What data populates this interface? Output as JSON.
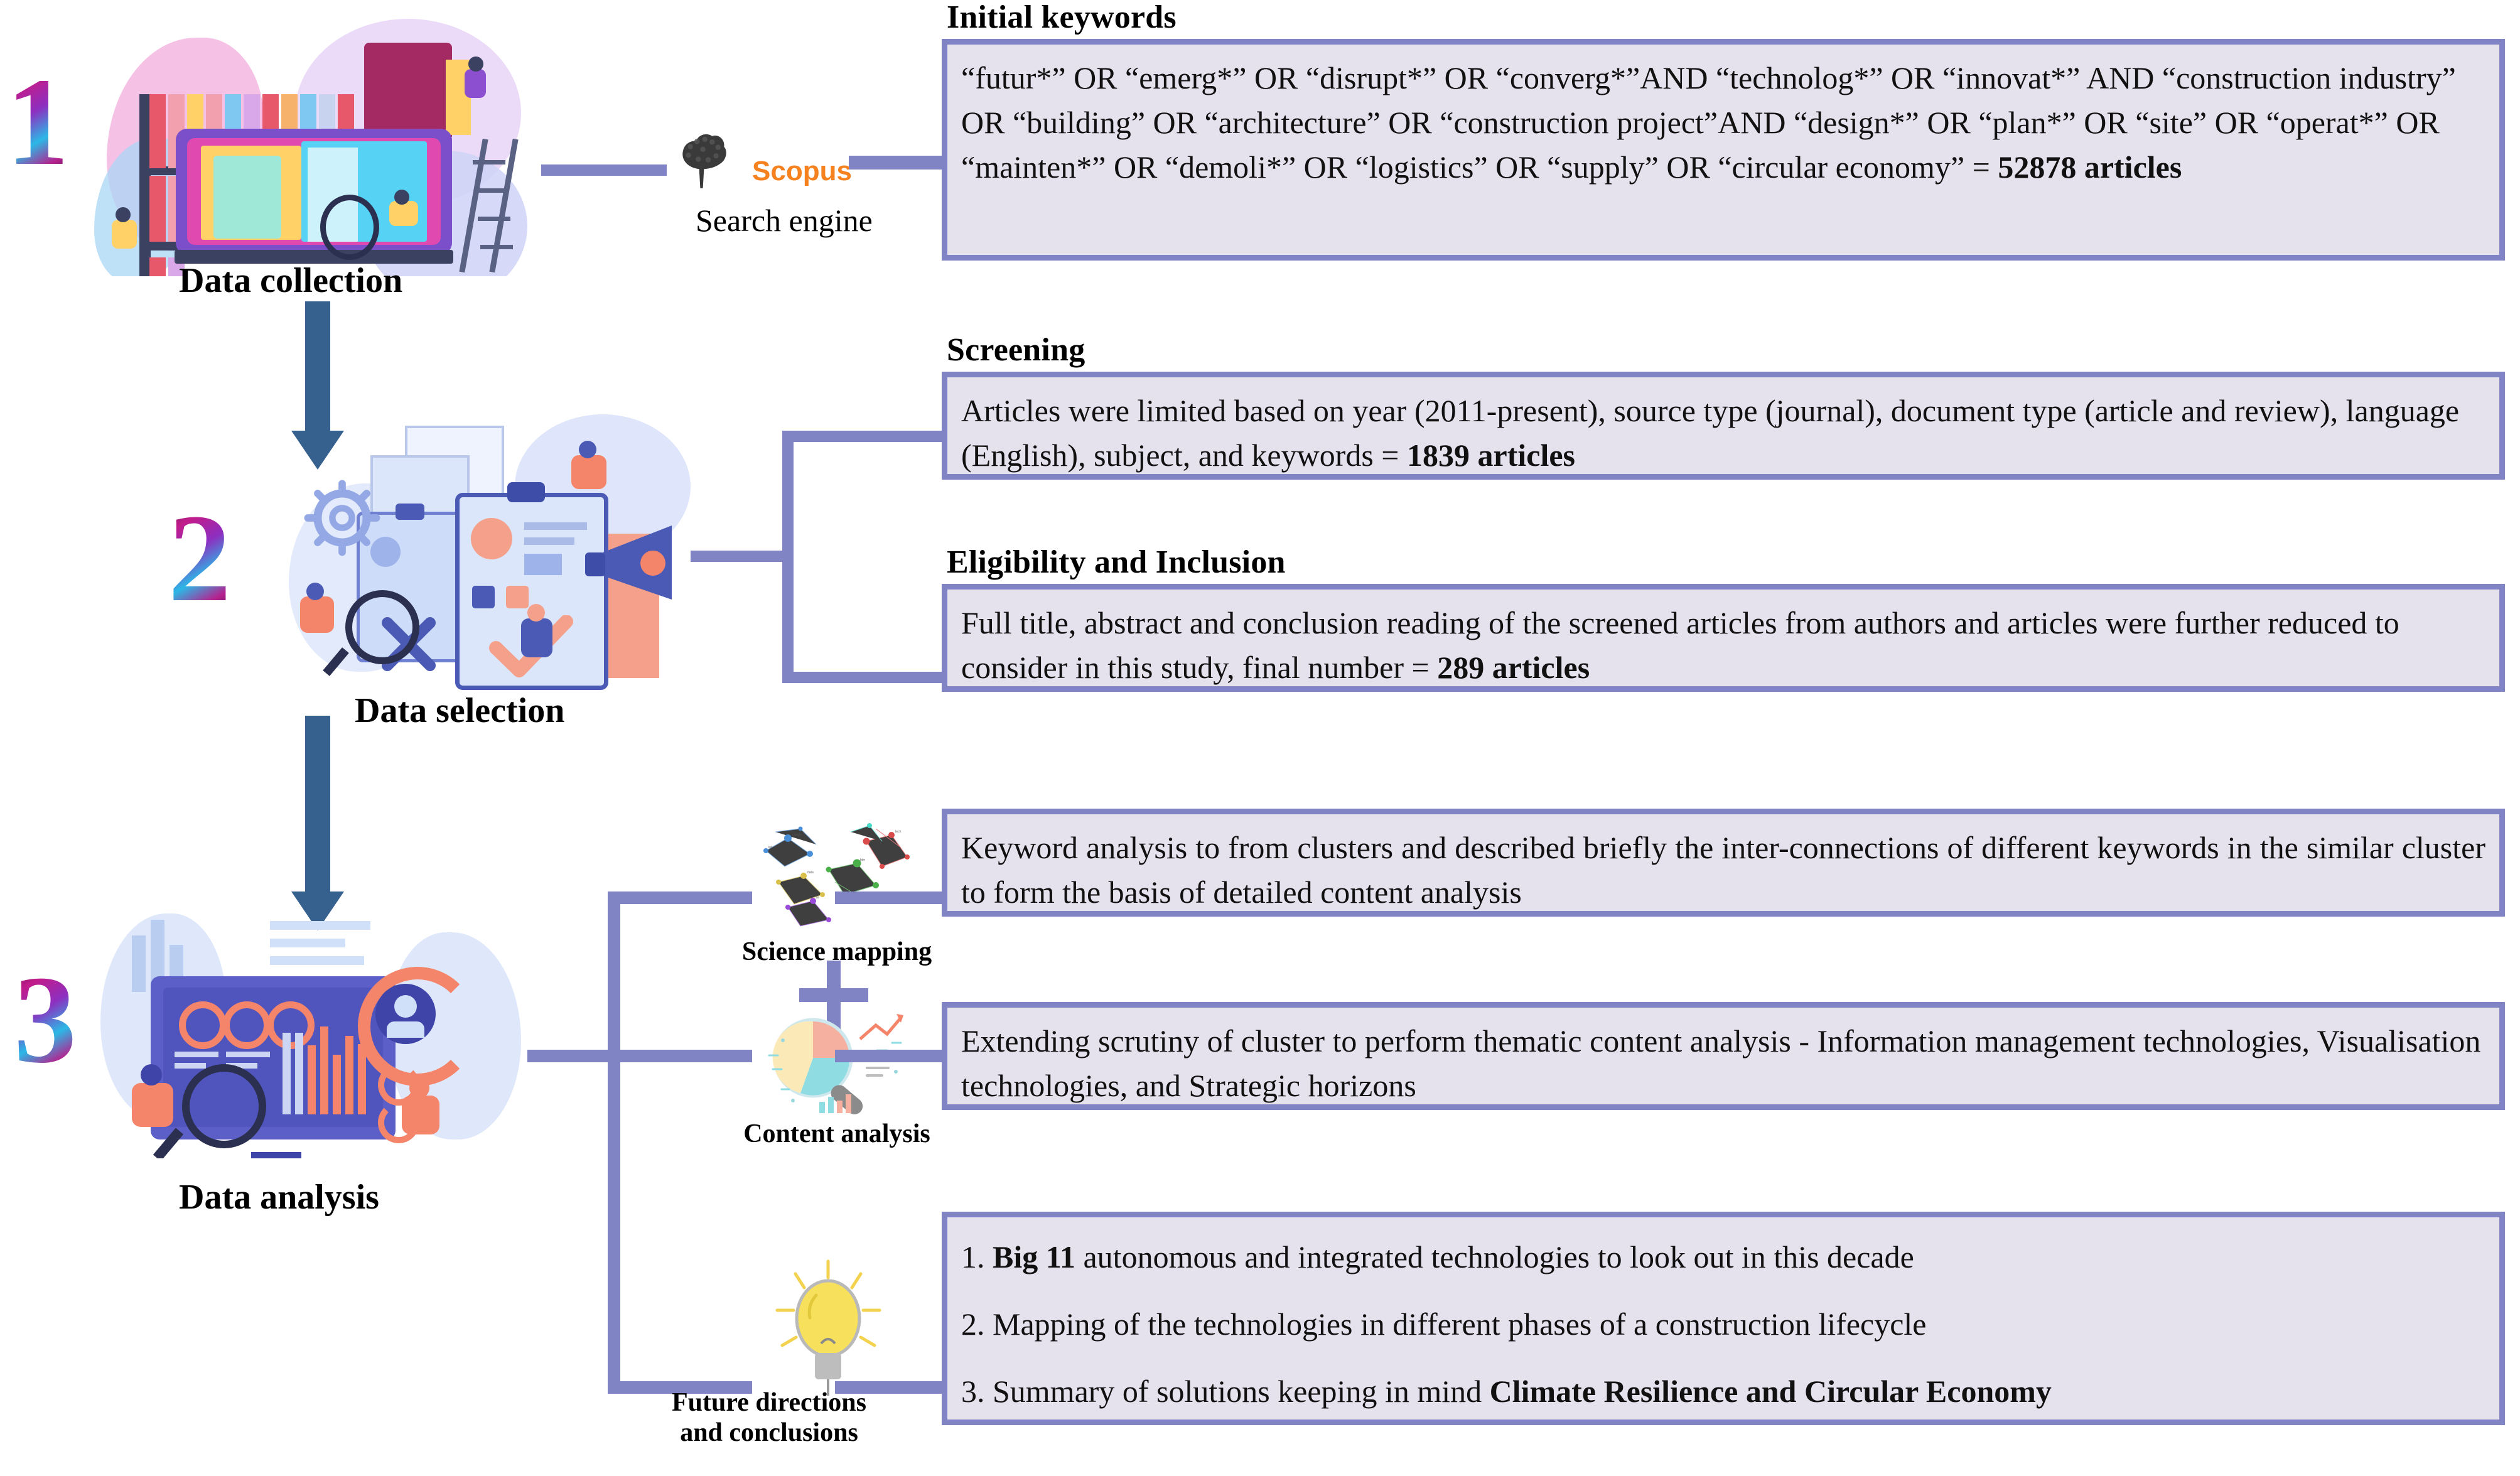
{
  "stages": [
    {
      "number": "1",
      "caption": "Data collection",
      "illustration": "data-collection-illustration"
    },
    {
      "number": "2",
      "caption": "Data selection",
      "illustration": "data-selection-illustration"
    },
    {
      "number": "3",
      "caption": "Data analysis",
      "illustration": "data-analysis-illustration"
    }
  ],
  "search_engine": {
    "logo_label": "Scopus",
    "caption": "Search engine",
    "icon": "elsevier-tree-icon",
    "logo_color": "#f5821f"
  },
  "sections": {
    "initial_keywords": {
      "header": "Initial keywords",
      "body": "“futur*” OR “emerg*” OR “disrupt*” OR “converg*”AND “technolog*” OR “innovat*” AND “construction industry” OR “building” OR “architecture” OR “construction project”AND “design*” OR “plan*” OR “site” OR “operat*” OR “mainten*” OR “demoli*” OR “logistics” OR “supply” OR “circular economy” = ",
      "result": "52878 articles"
    },
    "screening": {
      "header": "Screening",
      "body": "Articles were limited based on year (2011-present), source type (journal), document type (article and review), language (English), subject, and keywords = ",
      "result": "1839 articles"
    },
    "eligibility": {
      "header": "Eligibility and Inclusion",
      "body": "Full title, abstract and conclusion reading of the screened articles from authors and articles were further reduced to consider in this study, final number  = ",
      "result": "289 articles"
    },
    "science_mapping": {
      "label": "Science mapping",
      "icon": "network-cluster-map-icon",
      "body": "Keyword analysis to from clusters and described briefly the inter-connections of different keywords in the similar cluster to form the basis of detailed content analysis"
    },
    "content_analysis": {
      "label": "Content analysis",
      "icon": "pie-chart-magnifier-icon",
      "body": "Extending scrutiny of cluster to perform thematic content analysis - Information management technologies, Visualisation technologies, and Strategic horizons"
    },
    "future_directions": {
      "label_line1": "Future directions",
      "label_line2": "and conclusions",
      "icon": "lightbulb-icon",
      "items": [
        {
          "num": "1. ",
          "bold": "Big 11",
          "rest": " autonomous and integrated technologies to look out in this decade"
        },
        {
          "num": "2. ",
          "bold": "",
          "rest": "Mapping of the technologies in different phases of a construction lifecycle"
        },
        {
          "num": "3. ",
          "bold": "",
          "rest": "Summary of solutions keeping in mind ",
          "tail_bold": "Climate Resilience and Circular Economy"
        }
      ]
    }
  },
  "colors": {
    "box_border": "#8184c4",
    "box_fill": "#e5e2ee",
    "connector": "#8184c4",
    "stage_arrow": "#36618e",
    "scopus_orange": "#f5821f"
  }
}
